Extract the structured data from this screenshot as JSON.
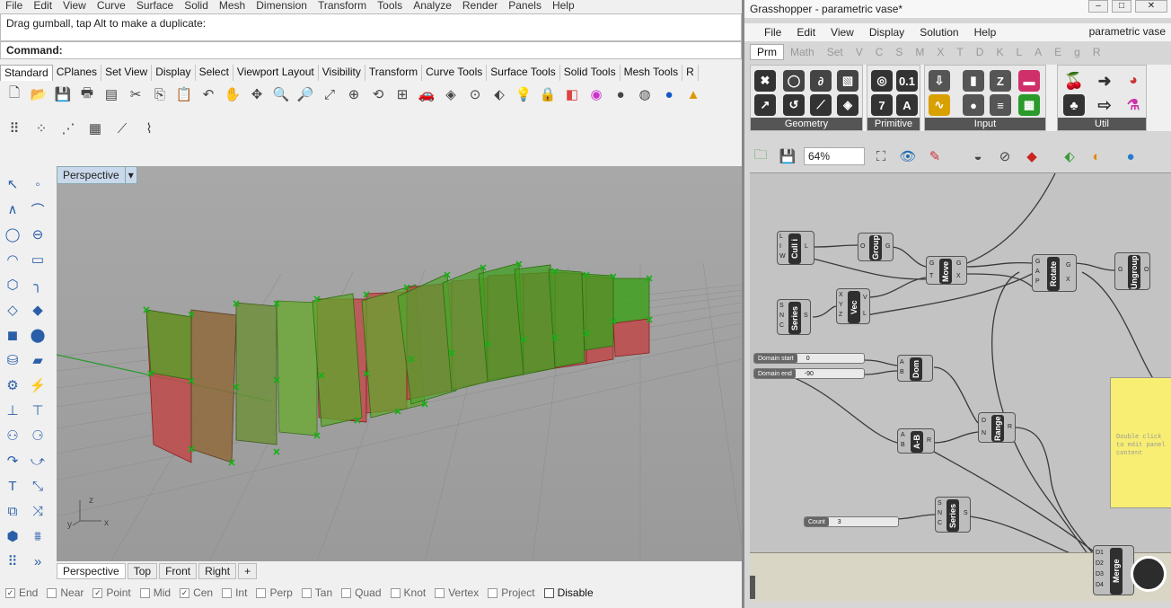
{
  "rhino": {
    "menu": [
      "File",
      "Edit",
      "View",
      "Curve",
      "Surface",
      "Solid",
      "Mesh",
      "Dimension",
      "Transform",
      "Tools",
      "Analyze",
      "Render",
      "Panels",
      "Help"
    ],
    "command_history": "Drag gumball, tap Alt to make a duplicate:",
    "command_prompt": "Command:",
    "toolbar_tabs": [
      "Standard",
      "CPlanes",
      "Set View",
      "Display",
      "Select",
      "Viewport Layout",
      "Visibility",
      "Transform",
      "Curve Tools",
      "Surface Tools",
      "Solid Tools",
      "Mesh Tools",
      "R"
    ],
    "viewport_title": "Perspective",
    "viewport_tabs": [
      "Perspective",
      "Top",
      "Front",
      "Right"
    ],
    "axes": {
      "x": "x",
      "y": "y",
      "z": "z"
    },
    "osnaps": [
      {
        "label": "End",
        "checked": true
      },
      {
        "label": "Near",
        "checked": false
      },
      {
        "label": "Point",
        "checked": true
      },
      {
        "label": "Mid",
        "checked": false
      },
      {
        "label": "Cen",
        "checked": true
      },
      {
        "label": "Int",
        "checked": false
      },
      {
        "label": "Perp",
        "checked": false
      },
      {
        "label": "Tan",
        "checked": false
      },
      {
        "label": "Quad",
        "checked": false
      },
      {
        "label": "Knot",
        "checked": false
      },
      {
        "label": "Vertex",
        "checked": false
      },
      {
        "label": "Project",
        "checked": false
      },
      {
        "label": "Disable",
        "checked": false
      }
    ]
  },
  "gh": {
    "title": "Grasshopper - parametric vase*",
    "menu": [
      "File",
      "Edit",
      "View",
      "Display",
      "Solution",
      "Help"
    ],
    "doc_name": "parametric vase",
    "tabs": [
      "Prm",
      "Math",
      "Set",
      "V",
      "C",
      "S",
      "M",
      "X",
      "T",
      "D",
      "K",
      "L",
      "A",
      "E",
      "g",
      "R"
    ],
    "groups": [
      "Geometry",
      "Primitive",
      "Input",
      "Util"
    ],
    "zoom": "64%",
    "nodes": {
      "cull": "Cull i",
      "group": "Group",
      "move": "Move",
      "rotate": "Rotate",
      "ungroup": "Ungroup",
      "series1": "Series",
      "vec": "Vec",
      "dom": "Dom",
      "range": "Range",
      "ab": "A-B",
      "series2": "Series",
      "merge": "Merge"
    },
    "sliders": {
      "domain_start_label": "Domain start",
      "domain_start_value": "0",
      "domain_end_label": "Domain end",
      "domain_end_value": "-90",
      "count_label": "Count",
      "count_value": "3"
    },
    "panel_text": "Double click to edit panel content"
  }
}
